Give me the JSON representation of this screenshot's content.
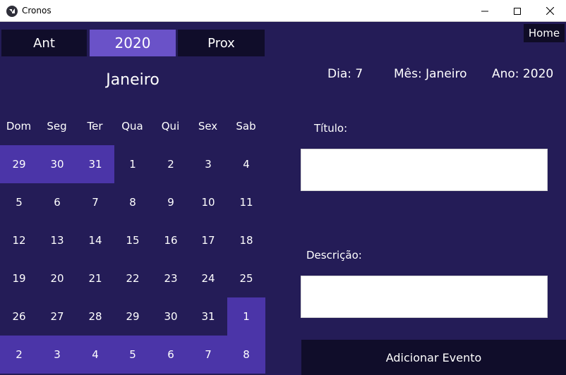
{
  "window": {
    "title": "Cronos",
    "minimize_glyph": "—",
    "maximize_glyph": "☐",
    "close_glyph": "✕"
  },
  "calendar": {
    "prev_label": "Ant",
    "year_label": "2020",
    "next_label": "Prox",
    "month": "Janeiro",
    "weekdays": [
      "Dom",
      "Seg",
      "Ter",
      "Qua",
      "Qui",
      "Sex",
      "Sab"
    ],
    "weeks": [
      [
        {
          "day": "29",
          "other_month": true
        },
        {
          "day": "30",
          "other_month": true
        },
        {
          "day": "31",
          "other_month": true
        },
        {
          "day": "1",
          "other_month": false
        },
        {
          "day": "2",
          "other_month": false
        },
        {
          "day": "3",
          "other_month": false
        },
        {
          "day": "4",
          "other_month": false
        }
      ],
      [
        {
          "day": "5",
          "other_month": false
        },
        {
          "day": "6",
          "other_month": false
        },
        {
          "day": "7",
          "other_month": false
        },
        {
          "day": "8",
          "other_month": false
        },
        {
          "day": "9",
          "other_month": false
        },
        {
          "day": "10",
          "other_month": false
        },
        {
          "day": "11",
          "other_month": false
        }
      ],
      [
        {
          "day": "12",
          "other_month": false
        },
        {
          "day": "13",
          "other_month": false
        },
        {
          "day": "14",
          "other_month": false
        },
        {
          "day": "15",
          "other_month": false
        },
        {
          "day": "16",
          "other_month": false
        },
        {
          "day": "17",
          "other_month": false
        },
        {
          "day": "18",
          "other_month": false
        }
      ],
      [
        {
          "day": "19",
          "other_month": false
        },
        {
          "day": "20",
          "other_month": false
        },
        {
          "day": "21",
          "other_month": false
        },
        {
          "day": "22",
          "other_month": false
        },
        {
          "day": "23",
          "other_month": false
        },
        {
          "day": "24",
          "other_month": false
        },
        {
          "day": "25",
          "other_month": false
        }
      ],
      [
        {
          "day": "26",
          "other_month": false
        },
        {
          "day": "27",
          "other_month": false
        },
        {
          "day": "28",
          "other_month": false
        },
        {
          "day": "29",
          "other_month": false
        },
        {
          "day": "30",
          "other_month": false
        },
        {
          "day": "31",
          "other_month": false
        },
        {
          "day": "1",
          "other_month": true
        }
      ],
      [
        {
          "day": "2",
          "other_month": true
        },
        {
          "day": "3",
          "other_month": true
        },
        {
          "day": "4",
          "other_month": true
        },
        {
          "day": "5",
          "other_month": true
        },
        {
          "day": "6",
          "other_month": true
        },
        {
          "day": "7",
          "other_month": true
        },
        {
          "day": "8",
          "other_month": true
        }
      ]
    ]
  },
  "header": {
    "home_label": "Home",
    "day_text": "Dia: 7",
    "month_text": "Mês: Janeiro",
    "year_text": "Ano: 2020"
  },
  "form": {
    "title_label": "Título:",
    "title_value": "",
    "description_label": "Descrição:",
    "description_value": "",
    "submit_label": "Adicionar Evento"
  },
  "colors": {
    "background": "#241c57",
    "dark_button": "#100d2a",
    "accent": "#6a52c8",
    "other_month_cell": "#4b35a8"
  }
}
